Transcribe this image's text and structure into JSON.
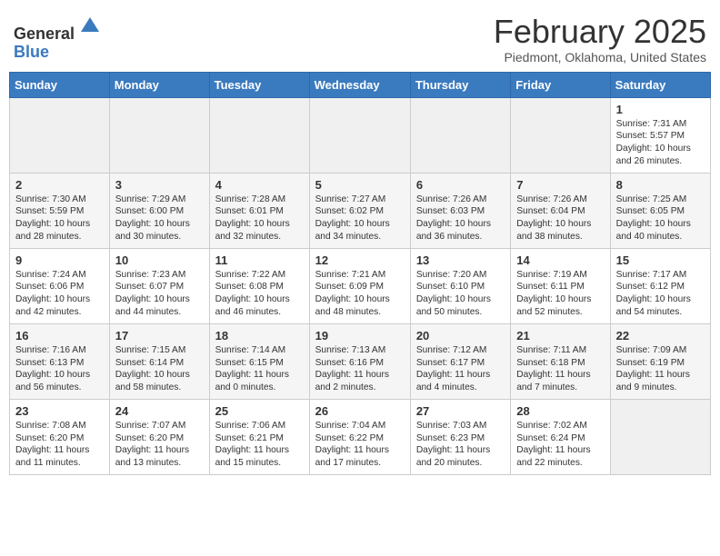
{
  "header": {
    "logo_general": "General",
    "logo_blue": "Blue",
    "month_title": "February 2025",
    "location": "Piedmont, Oklahoma, United States"
  },
  "days_of_week": [
    "Sunday",
    "Monday",
    "Tuesday",
    "Wednesday",
    "Thursday",
    "Friday",
    "Saturday"
  ],
  "weeks": [
    [
      {
        "day": "",
        "info": ""
      },
      {
        "day": "",
        "info": ""
      },
      {
        "day": "",
        "info": ""
      },
      {
        "day": "",
        "info": ""
      },
      {
        "day": "",
        "info": ""
      },
      {
        "day": "",
        "info": ""
      },
      {
        "day": "1",
        "info": "Sunrise: 7:31 AM\nSunset: 5:57 PM\nDaylight: 10 hours and 26 minutes."
      }
    ],
    [
      {
        "day": "2",
        "info": "Sunrise: 7:30 AM\nSunset: 5:59 PM\nDaylight: 10 hours and 28 minutes."
      },
      {
        "day": "3",
        "info": "Sunrise: 7:29 AM\nSunset: 6:00 PM\nDaylight: 10 hours and 30 minutes."
      },
      {
        "day": "4",
        "info": "Sunrise: 7:28 AM\nSunset: 6:01 PM\nDaylight: 10 hours and 32 minutes."
      },
      {
        "day": "5",
        "info": "Sunrise: 7:27 AM\nSunset: 6:02 PM\nDaylight: 10 hours and 34 minutes."
      },
      {
        "day": "6",
        "info": "Sunrise: 7:26 AM\nSunset: 6:03 PM\nDaylight: 10 hours and 36 minutes."
      },
      {
        "day": "7",
        "info": "Sunrise: 7:26 AM\nSunset: 6:04 PM\nDaylight: 10 hours and 38 minutes."
      },
      {
        "day": "8",
        "info": "Sunrise: 7:25 AM\nSunset: 6:05 PM\nDaylight: 10 hours and 40 minutes."
      }
    ],
    [
      {
        "day": "9",
        "info": "Sunrise: 7:24 AM\nSunset: 6:06 PM\nDaylight: 10 hours and 42 minutes."
      },
      {
        "day": "10",
        "info": "Sunrise: 7:23 AM\nSunset: 6:07 PM\nDaylight: 10 hours and 44 minutes."
      },
      {
        "day": "11",
        "info": "Sunrise: 7:22 AM\nSunset: 6:08 PM\nDaylight: 10 hours and 46 minutes."
      },
      {
        "day": "12",
        "info": "Sunrise: 7:21 AM\nSunset: 6:09 PM\nDaylight: 10 hours and 48 minutes."
      },
      {
        "day": "13",
        "info": "Sunrise: 7:20 AM\nSunset: 6:10 PM\nDaylight: 10 hours and 50 minutes."
      },
      {
        "day": "14",
        "info": "Sunrise: 7:19 AM\nSunset: 6:11 PM\nDaylight: 10 hours and 52 minutes."
      },
      {
        "day": "15",
        "info": "Sunrise: 7:17 AM\nSunset: 6:12 PM\nDaylight: 10 hours and 54 minutes."
      }
    ],
    [
      {
        "day": "16",
        "info": "Sunrise: 7:16 AM\nSunset: 6:13 PM\nDaylight: 10 hours and 56 minutes."
      },
      {
        "day": "17",
        "info": "Sunrise: 7:15 AM\nSunset: 6:14 PM\nDaylight: 10 hours and 58 minutes."
      },
      {
        "day": "18",
        "info": "Sunrise: 7:14 AM\nSunset: 6:15 PM\nDaylight: 11 hours and 0 minutes."
      },
      {
        "day": "19",
        "info": "Sunrise: 7:13 AM\nSunset: 6:16 PM\nDaylight: 11 hours and 2 minutes."
      },
      {
        "day": "20",
        "info": "Sunrise: 7:12 AM\nSunset: 6:17 PM\nDaylight: 11 hours and 4 minutes."
      },
      {
        "day": "21",
        "info": "Sunrise: 7:11 AM\nSunset: 6:18 PM\nDaylight: 11 hours and 7 minutes."
      },
      {
        "day": "22",
        "info": "Sunrise: 7:09 AM\nSunset: 6:19 PM\nDaylight: 11 hours and 9 minutes."
      }
    ],
    [
      {
        "day": "23",
        "info": "Sunrise: 7:08 AM\nSunset: 6:20 PM\nDaylight: 11 hours and 11 minutes."
      },
      {
        "day": "24",
        "info": "Sunrise: 7:07 AM\nSunset: 6:20 PM\nDaylight: 11 hours and 13 minutes."
      },
      {
        "day": "25",
        "info": "Sunrise: 7:06 AM\nSunset: 6:21 PM\nDaylight: 11 hours and 15 minutes."
      },
      {
        "day": "26",
        "info": "Sunrise: 7:04 AM\nSunset: 6:22 PM\nDaylight: 11 hours and 17 minutes."
      },
      {
        "day": "27",
        "info": "Sunrise: 7:03 AM\nSunset: 6:23 PM\nDaylight: 11 hours and 20 minutes."
      },
      {
        "day": "28",
        "info": "Sunrise: 7:02 AM\nSunset: 6:24 PM\nDaylight: 11 hours and 22 minutes."
      },
      {
        "day": "",
        "info": ""
      }
    ]
  ]
}
